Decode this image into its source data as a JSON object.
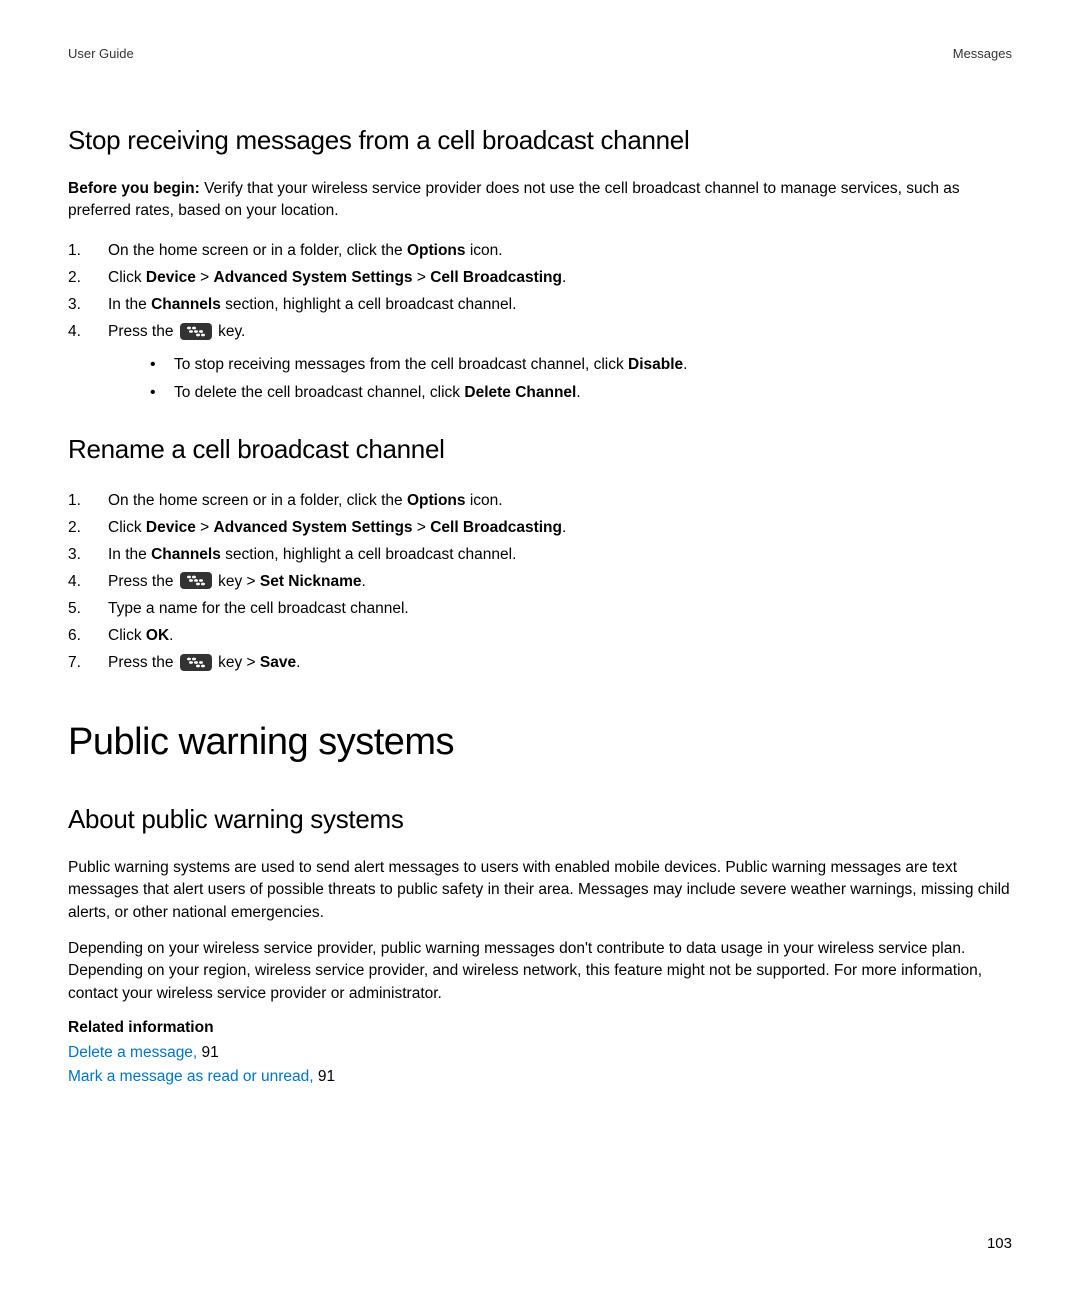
{
  "header": {
    "left": "User Guide",
    "right": "Messages"
  },
  "section1": {
    "heading": "Stop receiving messages from a cell broadcast channel",
    "before_label": "Before you begin: ",
    "before_text": "Verify that your wireless service provider does not use the cell broadcast channel to manage services, such as preferred rates, based on your location.",
    "steps": {
      "s1_a": "On the home screen or in a folder, click the ",
      "s1_b": "Options",
      "s1_c": " icon.",
      "s2_a": "Click ",
      "s2_b": "Device",
      "s2_c": " > ",
      "s2_d": "Advanced System Settings",
      "s2_e": " > ",
      "s2_f": "Cell Broadcasting",
      "s2_g": ".",
      "s3_a": "In the ",
      "s3_b": "Channels",
      "s3_c": " section, highlight a cell broadcast channel.",
      "s4_a": "Press the ",
      "s4_b": " key.",
      "b1_a": "To stop receiving messages from the cell broadcast channel, click ",
      "b1_b": "Disable",
      "b1_c": ".",
      "b2_a": "To delete the cell broadcast channel, click ",
      "b2_b": "Delete Channel",
      "b2_c": "."
    }
  },
  "section2": {
    "heading": "Rename a cell broadcast channel",
    "steps": {
      "s1_a": "On the home screen or in a folder, click the ",
      "s1_b": "Options",
      "s1_c": " icon.",
      "s2_a": "Click ",
      "s2_b": "Device",
      "s2_c": " > ",
      "s2_d": "Advanced System Settings",
      "s2_e": " > ",
      "s2_f": "Cell Broadcasting",
      "s2_g": ".",
      "s3_a": "In the ",
      "s3_b": "Channels",
      "s3_c": " section, highlight a cell broadcast channel.",
      "s4_a": "Press the ",
      "s4_b": " key > ",
      "s4_c": "Set Nickname",
      "s4_d": ".",
      "s5": "Type a name for the cell broadcast channel.",
      "s6_a": "Click ",
      "s6_b": "OK",
      "s6_c": ".",
      "s7_a": "Press the ",
      "s7_b": " key > ",
      "s7_c": "Save",
      "s7_d": "."
    }
  },
  "main_heading": "Public warning systems",
  "section3": {
    "heading": "About public warning systems",
    "p1": "Public warning systems are used to send alert messages to users with enabled mobile devices. Public warning messages are text messages that alert users of possible threats to public safety in their area. Messages may include severe weather warnings, missing child alerts, or other national emergencies.",
    "p2": "Depending on your wireless service provider, public warning messages don't contribute to data usage in your wireless service plan. Depending on your region, wireless service provider, and wireless network, this feature might not be supported. For more information, contact your wireless service provider or administrator."
  },
  "related": {
    "heading": "Related information",
    "link1_text": "Delete a message, ",
    "link1_page": "91",
    "link2_text": "Mark a message as read or unread, ",
    "link2_page": "91"
  },
  "page_number": "103"
}
